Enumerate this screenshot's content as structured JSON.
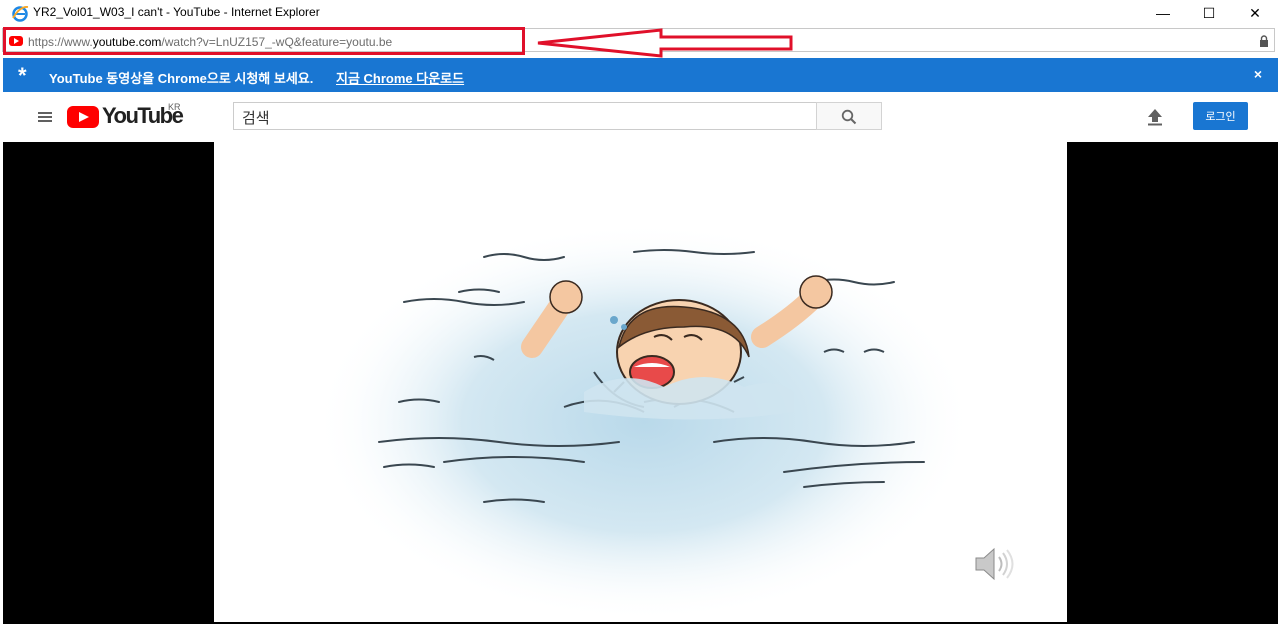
{
  "window": {
    "title": "YR2_Vol01_W03_I can't - YouTube - Internet Explorer",
    "minimize_glyph": "—",
    "maximize_glyph": "☐",
    "close_glyph": "✕"
  },
  "address_bar": {
    "url_prefix": "https://www.",
    "url_domain": "youtube.com",
    "url_rest": "/watch?v=LnUZ157_-wQ&feature=youtu.be"
  },
  "banner": {
    "star": "*",
    "text": "YouTube 동영상을 Chrome으로 시청해 보세요.",
    "link": "지금 Chrome 다운로드",
    "close": "×"
  },
  "header": {
    "logo_text": "YouTube",
    "region": "KR",
    "search_placeholder": "검색",
    "login_label": "로그인"
  },
  "colors": {
    "annotation_red": "#e0102a",
    "banner_blue": "#1976d2",
    "youtube_red": "#ff0000"
  },
  "icons": [
    "ie-icon",
    "youtube-favicon",
    "lock-icon",
    "menu-icon",
    "search-icon",
    "upload-icon",
    "speaker-icon"
  ]
}
